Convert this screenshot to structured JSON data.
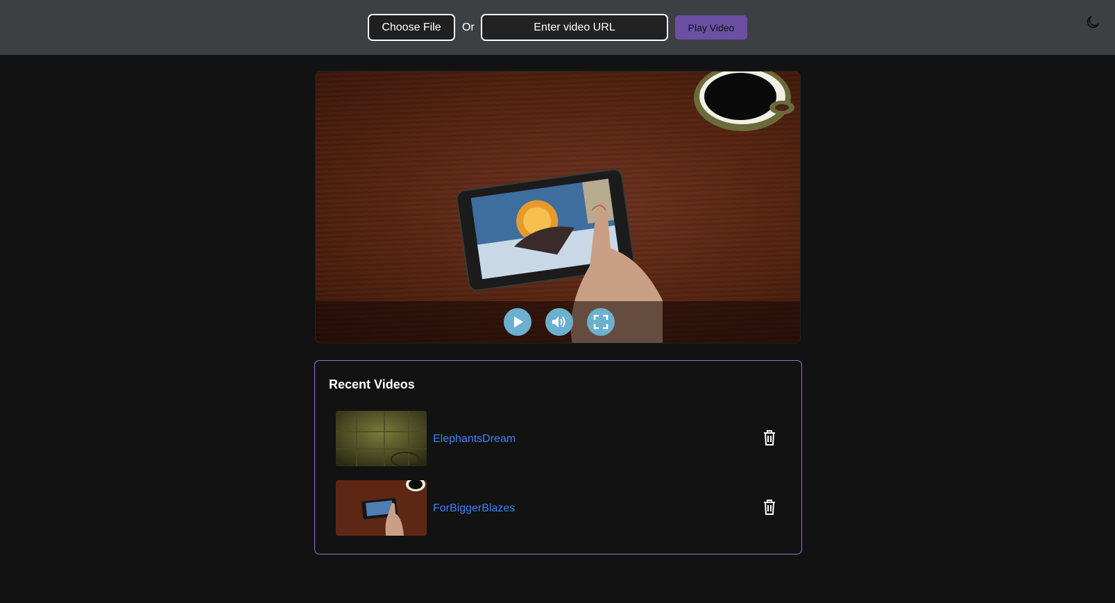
{
  "toolbar": {
    "choose_file_label": "Choose File",
    "or_label": "Or",
    "url_placeholder": "Enter video URL",
    "play_label": "Play Video",
    "theme_icon": "moon-icon"
  },
  "player": {
    "controls": {
      "play_icon": "play-icon",
      "volume_icon": "volume-icon",
      "fullscreen_icon": "fullscreen-icon"
    }
  },
  "recent": {
    "title": "Recent Videos",
    "items": [
      {
        "name": "ElephantsDream",
        "delete_icon": "trash-icon"
      },
      {
        "name": "ForBiggerBlazes",
        "delete_icon": "trash-icon"
      }
    ]
  },
  "colors": {
    "topbar": "#3d4043",
    "accent": "#6a4fa3",
    "panel_border": "#9a6fe0",
    "link": "#3b82f6",
    "control": "#6bb0cf",
    "background": "#121212"
  }
}
